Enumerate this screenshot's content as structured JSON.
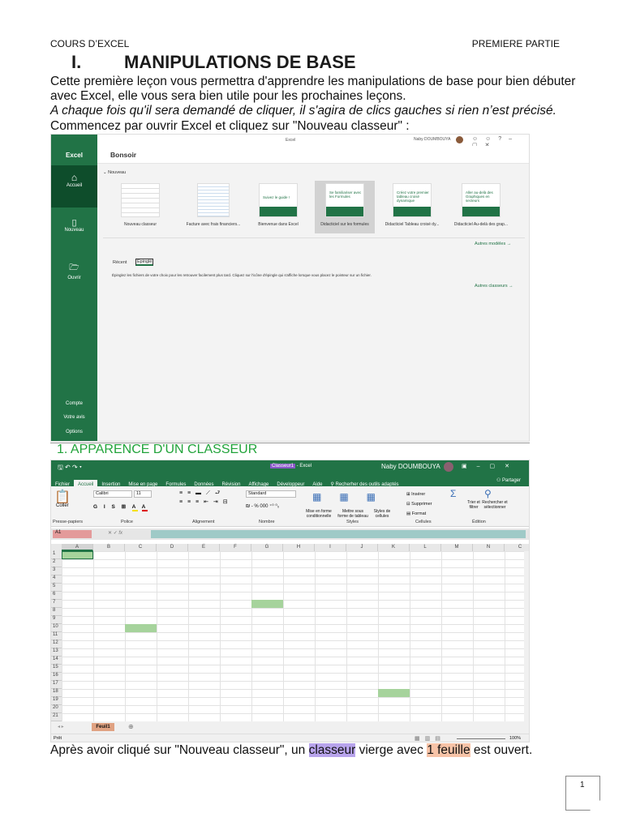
{
  "header": {
    "left": "COURS D’EXCEL",
    "right": "PREMIERE PARTIE"
  },
  "heading": {
    "number": "I.",
    "title": "MANIPULATIONS DE BASE"
  },
  "paragraphs": [
    "Cette première leçon vous permettra d'apprendre les manipulations de base pour bien débuter",
    "avec Excel, elle vous sera bien utile pour les prochaines leçons.",
    "A chaque fois qu'il sera demandé de cliquer, il s'agira de clics gauches si rien n’est précisé.",
    "Commencez par ouvrir Excel et cliquez sur \"Nouveau classeur\" :"
  ],
  "start": {
    "window_title": "Excel",
    "user": "Naby DOUMBOUYA",
    "app": "Excel",
    "greeting": "Bonsoir",
    "section": "Nouveau",
    "sidebar": [
      "Accueil",
      "Nouveau",
      "Ouvrir"
    ],
    "sidebar_bottom": [
      "Compte",
      "Votre avis",
      "Options"
    ],
    "templates": [
      {
        "label": "Nouveau classeur",
        "thumb": ""
      },
      {
        "label": "Facture avec frais financiers...",
        "thumb": ""
      },
      {
        "label": "Bienvenue dans Excel",
        "thumb": "Suivez le guide !"
      },
      {
        "label": "Didacticiel sur les formules",
        "thumb": "Se familiariser avec les Formules"
      },
      {
        "label": "Didacticiel Tableau croisé dy...",
        "thumb": "Créez votre premier tableau croisé dynamique"
      },
      {
        "label": "Didacticiel Au-delà des grap...",
        "thumb": "Aller au-delà des Graphiques en secteurs"
      }
    ],
    "more_templates": "Autres modèles →",
    "tab_recent": "Récent",
    "tab_pinned": "Epinglé",
    "pinned_desc": "Épinglez les fichiers de votre choix pour les retrouver facilement plus tard. Cliquez sur l'icône d'épingle qui s'affiche lorsque vous placez le pointeur sur un fichier.",
    "more_files": "Autres classeurs →"
  },
  "section1": "1.  APPARENCE D'UN CLASSEUR",
  "excel": {
    "doc": "Classeur1",
    "app": " - Excel",
    "user": "Naby DOUMBOUYA",
    "tabs": [
      "Fichier",
      "Accueil",
      "Insertion",
      "Mise en page",
      "Formules",
      "Données",
      "Révision",
      "Affichage",
      "Développeur",
      "Aide"
    ],
    "search": "Recherher des outils adaptés",
    "share": "Partager",
    "font": "Calibri",
    "size": "11",
    "format": "Standard",
    "paste": "Coller",
    "groups": [
      "Presse-papiers",
      "Police",
      "Alignement",
      "Nombre",
      "Styles",
      "Cellules",
      "Édition"
    ],
    "styles": [
      "Mise en forme conditionnelle",
      "Mettre sous forme de tableau",
      "Styles de cellules"
    ],
    "cells": [
      "Insérer",
      "Supprimer",
      "Format"
    ],
    "edit": [
      "Trier et filtrer",
      "Rechercher et sélectionner"
    ],
    "namebox": "A1",
    "fx": "fx",
    "columns": [
      "A",
      "B",
      "C",
      "D",
      "E",
      "F",
      "G",
      "H",
      "I",
      "J",
      "K",
      "L",
      "M",
      "N",
      "C"
    ],
    "rows": [
      "1",
      "2",
      "3",
      "4",
      "5",
      "6",
      "7",
      "8",
      "9",
      "10",
      "11",
      "12",
      "13",
      "14",
      "15",
      "16",
      "17",
      "18",
      "19",
      "20",
      "21"
    ],
    "sheet": "Feuil1",
    "status": "Prêt",
    "zoom": "100%",
    "selected_cells": [
      "A1",
      "G7",
      "C10",
      "K18"
    ]
  },
  "final": {
    "a": "Après avoir cliqué sur \"Nouveau classeur\", un ",
    "b": "classeur",
    "c": " vierge avec ",
    "d": "1 feuille",
    "e": " est ouvert."
  },
  "page_number": "1"
}
